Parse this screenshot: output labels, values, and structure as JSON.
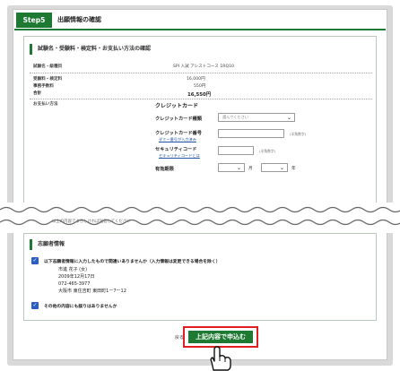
{
  "header": {
    "step_label": "Step5",
    "title": "出願情報の確認"
  },
  "summary": {
    "section_title": "試験名・受験料・検定料・お支払い方法の確認",
    "rows": [
      {
        "key": "試験名・級種目",
        "value": "SPI 入試 アシストコース 1RQ10"
      },
      {
        "key": "受験料・検定料",
        "value": "16,000円"
      },
      {
        "key": "事務手数料",
        "value": "550円"
      },
      {
        "key": "合計",
        "value": "16,550円"
      },
      {
        "key": "お支払い方法",
        "value": ""
      }
    ]
  },
  "payment": {
    "title": "クレジットカード",
    "card_type_label": "クレジットカード種類",
    "card_type_value": "選んでください",
    "card_number_label": "クレジットカード番号",
    "card_number_link": "ダミー番号が入力済み",
    "card_number_hint": "(半角数字)",
    "security_label": "セキュリティコード",
    "security_link": "セキュリティコードとは",
    "security_hint": "(半角数字)",
    "expiry_label": "有効期限",
    "month_unit": "月",
    "year_unit": "年"
  },
  "torn_text": "以上の内容でよろしければ送信してください",
  "confirm": {
    "section_title": "志願者情報",
    "check1_label": "以下志願者情報に入力したもので間違いありませんか（入力情報は変更できる場合を除く）",
    "applicant": {
      "name": "市進 花子 (女)",
      "birthday": "2009年12月17日",
      "phone": "072-465-3977",
      "address": "大阪市 東住吉町 東田町1ー7ー12"
    },
    "check2_label": "その他の内容にも誤りはありませんか"
  },
  "buttons": {
    "back": "戻る",
    "submit": "上記内容で申込む"
  }
}
